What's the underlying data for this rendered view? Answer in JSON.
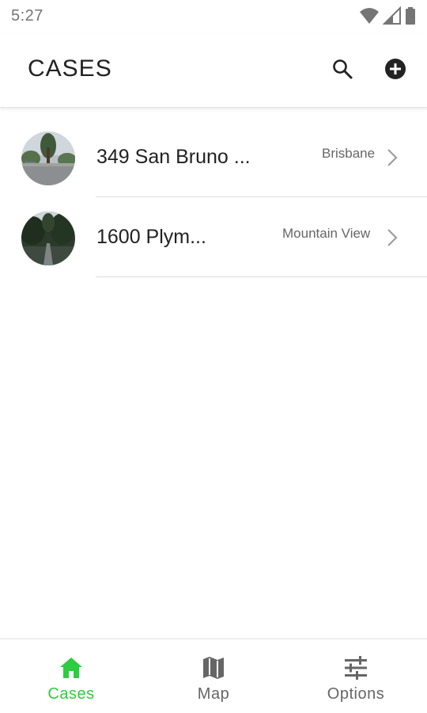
{
  "status_bar": {
    "time": "5:27",
    "icons": [
      "wifi-icon",
      "signal-icon",
      "battery-icon"
    ]
  },
  "app_bar": {
    "title": "CASES",
    "actions": [
      "search-icon",
      "add-circle-icon"
    ]
  },
  "cases": [
    {
      "address": "349 San Bruno ...",
      "city": "Brisbane",
      "thumbnail": "street-photo"
    },
    {
      "address": "1600 Plym...",
      "city": "Mountain View",
      "thumbnail": "street-photo"
    }
  ],
  "bottom_nav": {
    "items": [
      {
        "label": "Cases",
        "icon": "home-icon",
        "active": true
      },
      {
        "label": "Map",
        "icon": "map-icon",
        "active": false
      },
      {
        "label": "Options",
        "icon": "tune-icon",
        "active": false
      }
    ]
  },
  "colors": {
    "accent": "#2ecc40",
    "inactive": "#666666",
    "text": "#222222",
    "divider": "#dddddd"
  }
}
